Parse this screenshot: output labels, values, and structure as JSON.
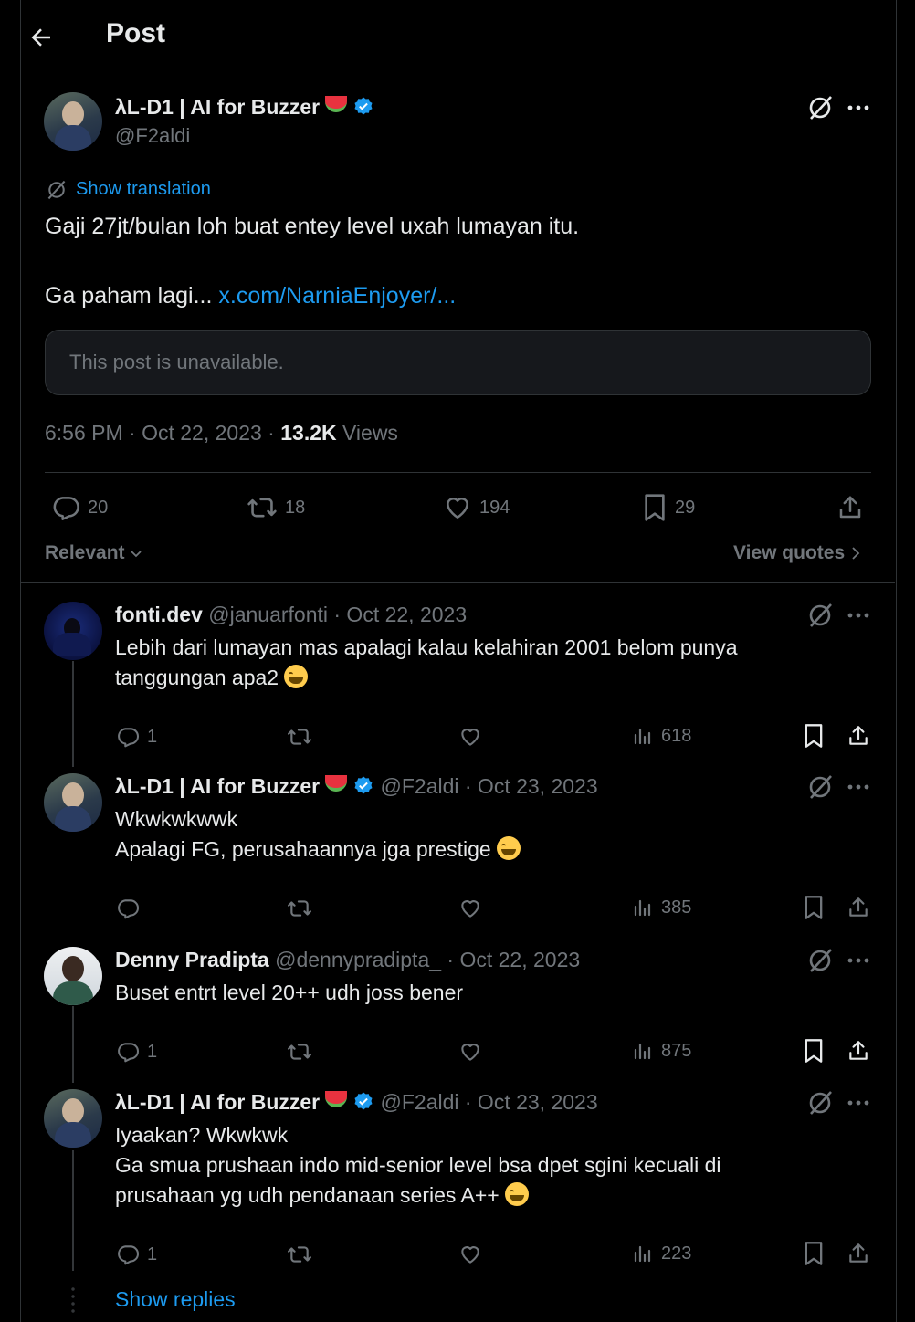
{
  "header": {
    "title": "Post"
  },
  "main_post": {
    "name": "λL-D1 | AI for Buzzer",
    "handle": "@F2aldi",
    "show_translation": "Show translation",
    "line1": "Gaji 27jt/bulan loh buat entey level uxah lumayan itu.",
    "line2_prefix": "Ga paham lagi... ",
    "link": "x.com/NarniaEnjoyer/...",
    "quote_unavailable": "This post is unavailable.",
    "time": "6:56 PM · Oct 22, 2023 · ",
    "views_count": "13.2K",
    "views_label": " Views",
    "stats": {
      "replies": "20",
      "reposts": "18",
      "likes": "194",
      "bookmarks": "29"
    }
  },
  "sort": {
    "label": "Relevant",
    "view_quotes": "View quotes"
  },
  "replies": [
    {
      "name": "fonti.dev",
      "meta": "@januarfonti · Oct 22, 2023",
      "lines": [
        "Lebih dari lumayan mas apalagi kalau kelahiran 2001 belom punya",
        "tanggungan apa2"
      ],
      "replies": "1",
      "views": "618"
    },
    {
      "name": "λL-D1 | AI for Buzzer",
      "meta": "@F2aldi · Oct 23, 2023",
      "lines": [
        "Wkwkwkwwk",
        "Apalagi FG, perusahaannya jga prestige"
      ],
      "replies": "",
      "views": "385"
    },
    {
      "name": "Denny Pradipta",
      "meta": "@dennypradipta_ · Oct 22, 2023",
      "lines": [
        "Buset entrt level 20++ udh joss bener"
      ],
      "replies": "1",
      "views": "875"
    },
    {
      "name": "λL-D1 | AI for Buzzer",
      "meta": "@F2aldi · Oct 23, 2023",
      "lines": [
        "Iyaakan? Wkwkwk",
        "Ga smua prushaan indo mid-senior level bsa dpet sgini kecuali di",
        "prusahaan yg udh pendanaan series A++"
      ],
      "replies": "1",
      "views": "223"
    }
  ],
  "show_replies": "Show replies",
  "colors": {
    "accent": "#1d9bf0",
    "bg": "#000000",
    "text": "#e7e9ea",
    "muted": "#71767b"
  }
}
